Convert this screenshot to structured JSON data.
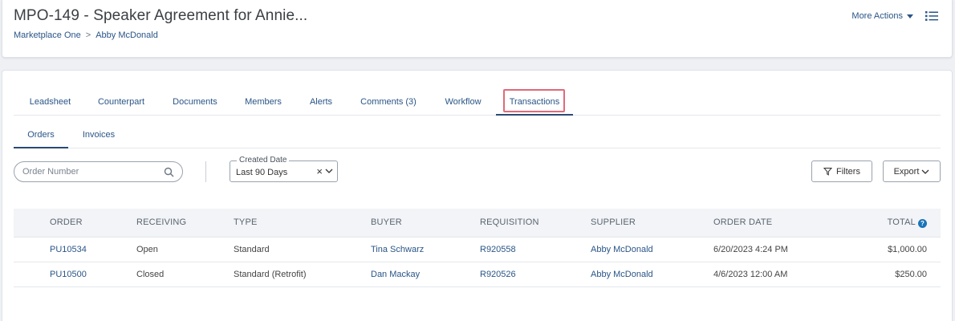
{
  "header": {
    "title": "MPO-149 - Speaker Agreement for Annie...",
    "breadcrumb": [
      {
        "label": "Marketplace One"
      },
      {
        "sep": ">"
      },
      {
        "label": "Abby McDonald"
      }
    ],
    "more_actions_label": "More Actions"
  },
  "tabs": [
    {
      "label": "Leadsheet"
    },
    {
      "label": "Counterpart"
    },
    {
      "label": "Documents"
    },
    {
      "label": "Members"
    },
    {
      "label": "Alerts"
    },
    {
      "label": "Comments (3)"
    },
    {
      "label": "Workflow"
    },
    {
      "label": "Transactions",
      "active": true
    }
  ],
  "subtabs": [
    {
      "label": "Orders",
      "active": true
    },
    {
      "label": "Invoices"
    }
  ],
  "search": {
    "placeholder": "Order Number",
    "value": ""
  },
  "date_filter": {
    "legend": "Created Date",
    "value": "Last 90 Days",
    "clear": "×"
  },
  "buttons": {
    "filters": "Filters",
    "export": "Export"
  },
  "table": {
    "columns": [
      "ORDER",
      "RECEIVING",
      "TYPE",
      "BUYER",
      "REQUISITION",
      "SUPPLIER",
      "ORDER DATE",
      "TOTAL"
    ],
    "help_glyph": "?",
    "rows": [
      {
        "order": "PU10534",
        "receiving": "Open",
        "type": "Standard",
        "buyer": "Tina Schwarz",
        "requisition": "R920558",
        "supplier": "Abby McDonald",
        "order_date": "6/20/2023 4:24 PM",
        "total": "$1,000.00"
      },
      {
        "order": "PU10500",
        "receiving": "Closed",
        "type": "Standard (Retrofit)",
        "buyer": "Dan Mackay",
        "requisition": "R920526",
        "supplier": "Abby McDonald",
        "order_date": "4/6/2023 12:00 AM",
        "total": "$250.00"
      }
    ]
  },
  "colors": {
    "link": "#2a5587",
    "active_tab_underline": "#2a4a72",
    "highlight": "#e06a7a",
    "help": "#1a73b8"
  }
}
